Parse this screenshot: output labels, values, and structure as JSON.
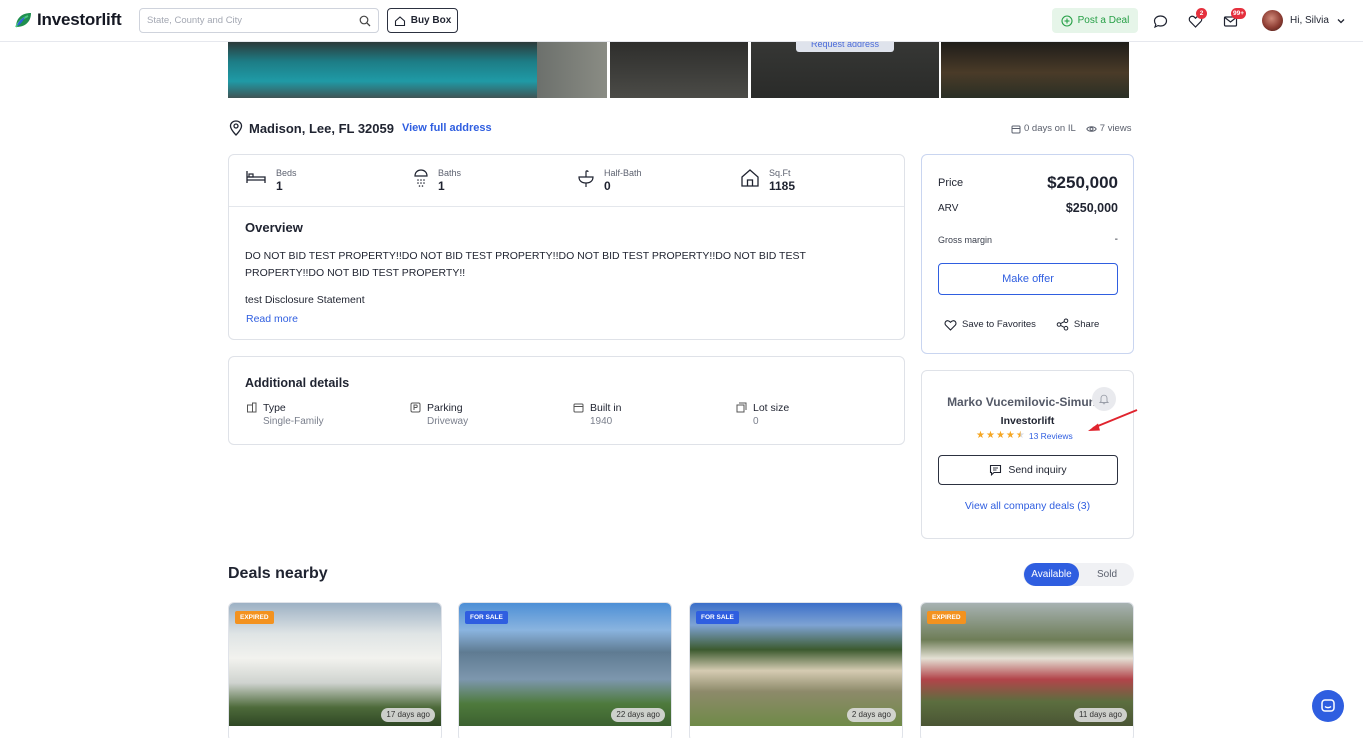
{
  "header": {
    "logo": "Investorlift",
    "search_placeholder": "State, County and City",
    "buybox_label": "Buy Box",
    "post_deal_label": "Post a Deal",
    "favorites_badge": "2",
    "inbox_badge": "99+",
    "greeting": "Hi, Silvia"
  },
  "gallery": {
    "request_address_label": "Request address"
  },
  "location": {
    "title": "Madison, Lee, FL 32059",
    "link": "View full address",
    "days_on": "0 days on IL",
    "views": "7 views"
  },
  "stats": [
    {
      "label": "Beds",
      "value": "1",
      "icon": "bed-icon"
    },
    {
      "label": "Baths",
      "value": "1",
      "icon": "shower-icon"
    },
    {
      "label": "Half-Bath",
      "value": "0",
      "icon": "sink-icon"
    },
    {
      "label": "Sq.Ft",
      "value": "1185",
      "icon": "house-icon"
    }
  ],
  "overview": {
    "heading": "Overview",
    "text": "DO NOT BID TEST PROPERTY!!DO NOT BID TEST PROPERTY!!DO NOT BID TEST PROPERTY!!DO NOT BID TEST PROPERTY!!DO NOT BID TEST PROPERTY!!",
    "disclosure": "test Disclosure Statement",
    "read_more": "Read more"
  },
  "additional": {
    "heading": "Additional details",
    "items": [
      {
        "label": "Type",
        "value": "Single-Family"
      },
      {
        "label": "Parking",
        "value": "Driveway"
      },
      {
        "label": "Built in",
        "value": "1940"
      },
      {
        "label": "Lot size",
        "value": "0"
      }
    ]
  },
  "pricing": {
    "price_label": "Price",
    "price_value": "$250,000",
    "arv_label": "ARV",
    "arv_value": "$250,000",
    "margin_label": "Gross margin",
    "margin_value": "-",
    "make_offer": "Make offer",
    "save_favorites": "Save to Favorites",
    "share": "Share"
  },
  "seller": {
    "name": "Marko Vucemilovic-Simun",
    "company": "Investorlift",
    "rating": 4.5,
    "reviews": "13 Reviews",
    "send_inquiry": "Send inquiry",
    "view_all": "View all company deals (3)"
  },
  "nearby": {
    "heading": "Deals nearby",
    "toggle_available": "Available",
    "toggle_sold": "Sold",
    "deals": [
      {
        "status": "EXPIRED",
        "days": "17 days ago"
      },
      {
        "status": "FOR SALE",
        "days": "22 days ago"
      },
      {
        "status": "FOR SALE",
        "days": "2 days ago"
      },
      {
        "status": "EXPIRED",
        "days": "11 days ago"
      }
    ]
  },
  "colors": {
    "accent": "#2f5ee0",
    "expired": "#f3921f",
    "success": "#27a047",
    "star": "#f5a623",
    "annotation_arrow": "#e0242e"
  }
}
